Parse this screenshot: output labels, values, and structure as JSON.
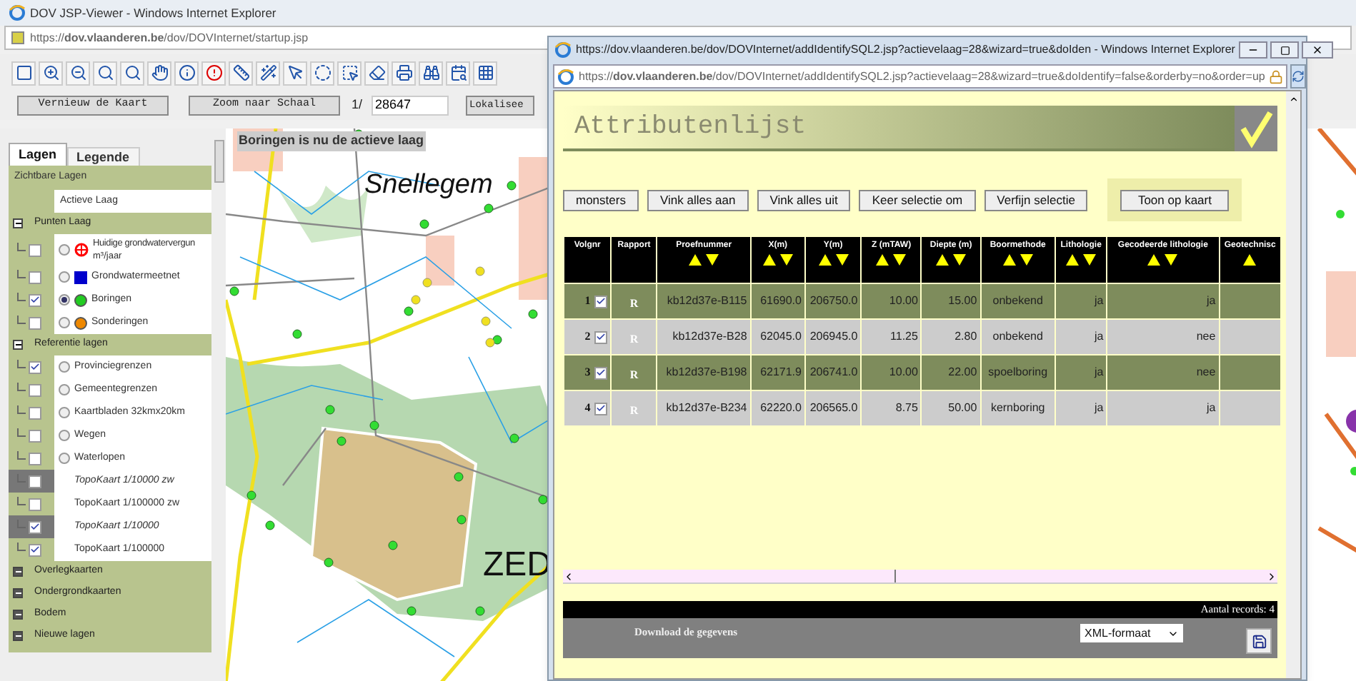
{
  "window": {
    "title": "DOV JSP-Viewer - Windows Internet Explorer",
    "url": "https://**dov.vlaanderen.be**/dov/DOVInternet/startup.jsp"
  },
  "map_controls": {
    "buttons": [
      "Vernieuw de Kaart",
      "Zoom naar Schaal"
    ],
    "scale_prefix": "1/",
    "scale_value": "28647",
    "locate_button": "Lokalisee"
  },
  "layers_panel": {
    "tabs": [
      {
        "label": "Lagen",
        "selected": true
      },
      {
        "label": "Legende",
        "selected": false
      }
    ],
    "header": "Zichtbare Lagen",
    "active_header": "Actieve Laag",
    "groups": [
      {
        "label": "Punten Laag",
        "expanded": true,
        "children": [
          {
            "label": "Huidige grondwatervergun",
            "label_line2": "m³/jaar",
            "checked": false,
            "active": false,
            "disabled": false,
            "kind": "ring",
            "color": "#ff0000"
          },
          {
            "label": "Grondwatermeetnet",
            "checked": false,
            "active": false,
            "disabled": false,
            "kind": "square",
            "color": "#0000cc"
          },
          {
            "label": "Boringen",
            "checked": true,
            "active": true,
            "disabled": false,
            "kind": "dot",
            "color": "#22cc22"
          },
          {
            "label": "Sonderingen",
            "checked": false,
            "active": false,
            "disabled": false,
            "kind": "dot",
            "color": "#ee8800"
          }
        ]
      },
      {
        "label": "Referentie lagen",
        "expanded": true,
        "children": [
          {
            "label": "Provinciegrenzen",
            "checked": true,
            "active": false,
            "disabled": false
          },
          {
            "label": "Gemeentegrenzen",
            "checked": false,
            "active": false,
            "disabled": false
          },
          {
            "label": "Kaartbladen 32kmx20km",
            "checked": false,
            "active": false,
            "disabled": false
          },
          {
            "label": "Wegen",
            "checked": false,
            "active": false,
            "disabled": false
          },
          {
            "label": "Waterlopen",
            "checked": false,
            "active": false,
            "disabled": false
          },
          {
            "label": "TopoKaart 1/10000 zw",
            "checked": false,
            "disabled": true
          },
          {
            "label": "TopoKaart 1/100000 zw",
            "checked": false,
            "disabled": false
          },
          {
            "label": "TopoKaart 1/10000",
            "checked": true,
            "disabled": true
          },
          {
            "label": "TopoKaart 1/100000",
            "checked": true,
            "disabled": false
          }
        ]
      },
      {
        "label": "Overlegkaarten",
        "expanded": false
      },
      {
        "label": "Ondergrondkaarten",
        "expanded": false
      },
      {
        "label": "Bodem",
        "expanded": false
      },
      {
        "label": "Nieuwe lagen",
        "expanded": false
      }
    ]
  },
  "map": {
    "banner": "Boringen is nu de actieve laag",
    "labels": [
      "Snellegem",
      "ZED"
    ]
  },
  "popup": {
    "title": "https://dov.vlaanderen.be/dov/DOVInternet/addIdentifySQL2.jsp?actievelaag=28&wizard=true&doIden - Windows Internet Explorer",
    "url": "https://**dov.vlaanderen.be**/dov/DOVInternet/addIdentifySQL2.jsp?actievelaag=28&wizard=true&doIdentify=false&orderby=no&order=up",
    "heading": "Attributenlijst",
    "buttons": [
      "monsters",
      "Vink alles aan",
      "Vink alles uit",
      "Keer selectie om",
      "Verfijn selectie"
    ],
    "map_button": "Toon op kaart",
    "table": {
      "columns": [
        {
          "label": "Volgnr",
          "kind": "plain"
        },
        {
          "label": "Rapport",
          "kind": "plain"
        },
        {
          "label": "Proefnummer",
          "kind": "sortable"
        },
        {
          "label": "X(m)",
          "kind": "sortable"
        },
        {
          "label": "Y(m)",
          "kind": "sortable"
        },
        {
          "label": "Z (mTAW)",
          "kind": "sortable"
        },
        {
          "label": "Diepte (m)",
          "kind": "sortable"
        },
        {
          "label": "Boormethode",
          "kind": "sortable"
        },
        {
          "label": "Lithologie",
          "kind": "sortable"
        },
        {
          "label": "Gecodeerde lithologie",
          "kind": "sortable"
        },
        {
          "label": "Geotechnisc",
          "kind": "ascending"
        }
      ],
      "rows": [
        {
          "checked": true,
          "cells": [
            "1",
            "R",
            "kb12d37e-B115",
            "61690.0",
            "206750.0",
            "10.00",
            "15.00",
            "onbekend",
            "ja",
            "ja"
          ]
        },
        {
          "checked": true,
          "cells": [
            "2",
            "R",
            "kb12d37e-B28",
            "62045.0",
            "206945.0",
            "11.25",
            "2.80",
            "onbekend",
            "ja",
            "nee"
          ]
        },
        {
          "checked": true,
          "cells": [
            "3",
            "R",
            "kb12d37e-B198",
            "62171.9",
            "206741.0",
            "10.00",
            "22.00",
            "spoelboring",
            "ja",
            "nee"
          ]
        },
        {
          "checked": true,
          "cells": [
            "4",
            "R",
            "kb12d37e-B234",
            "62220.0",
            "206565.0",
            "8.75",
            "50.00",
            "kernboring",
            "ja",
            "ja"
          ]
        }
      ]
    },
    "records": "Aantal records: 4",
    "download_label": "Download de gegevens",
    "format": "XML-formaat"
  }
}
